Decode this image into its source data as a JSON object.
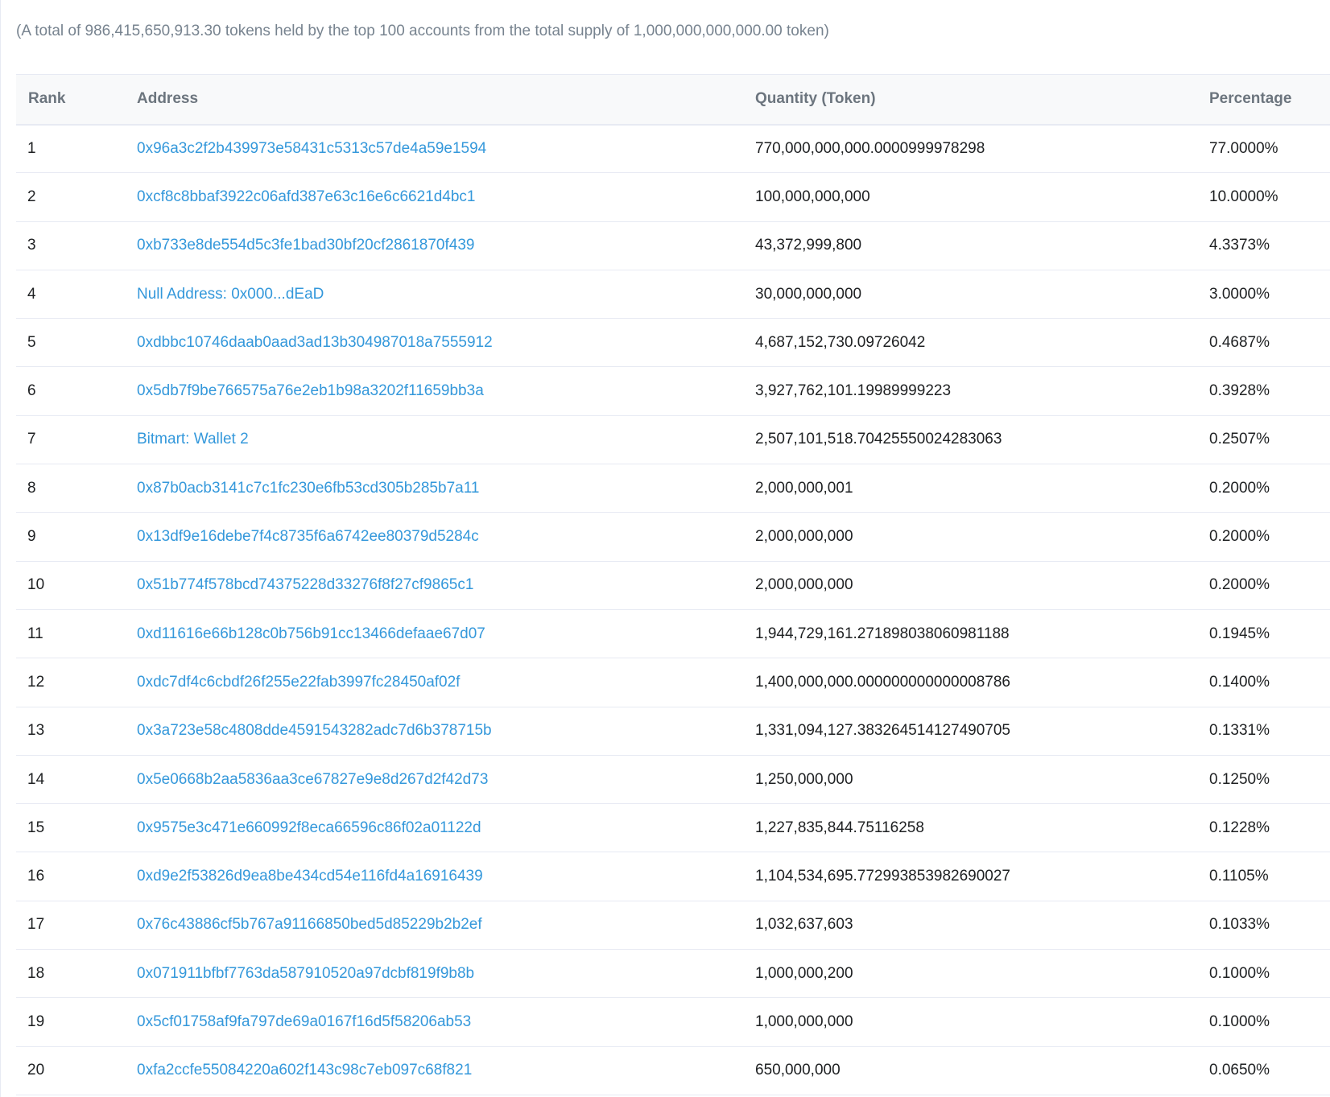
{
  "summary": "(A total of 986,415,650,913.30 tokens held by the top 100 accounts from the total supply of 1,000,000,000,000.00 token)",
  "table": {
    "headers": {
      "rank": "Rank",
      "address": "Address",
      "quantity": "Quantity (Token)",
      "percentage": "Percentage"
    },
    "rows": [
      {
        "rank": "1",
        "address": "0x96a3c2f2b439973e58431c5313c57de4a59e1594",
        "quantity": "770,000,000,000.0000999978298",
        "percentage": "77.0000%"
      },
      {
        "rank": "2",
        "address": "0xcf8c8bbaf3922c06afd387e63c16e6c6621d4bc1",
        "quantity": "100,000,000,000",
        "percentage": "10.0000%"
      },
      {
        "rank": "3",
        "address": "0xb733e8de554d5c3fe1bad30bf20cf2861870f439",
        "quantity": "43,372,999,800",
        "percentage": "4.3373%"
      },
      {
        "rank": "4",
        "address": "Null Address: 0x000...dEaD",
        "quantity": "30,000,000,000",
        "percentage": "3.0000%"
      },
      {
        "rank": "5",
        "address": "0xdbbc10746daab0aad3ad13b304987018a7555912",
        "quantity": "4,687,152,730.09726042",
        "percentage": "0.4687%"
      },
      {
        "rank": "6",
        "address": "0x5db7f9be766575a76e2eb1b98a3202f11659bb3a",
        "quantity": "3,927,762,101.19989999223",
        "percentage": "0.3928%"
      },
      {
        "rank": "7",
        "address": "Bitmart: Wallet 2",
        "quantity": "2,507,101,518.70425550024283063",
        "percentage": "0.2507%"
      },
      {
        "rank": "8",
        "address": "0x87b0acb3141c7c1fc230e6fb53cd305b285b7a11",
        "quantity": "2,000,000,001",
        "percentage": "0.2000%"
      },
      {
        "rank": "9",
        "address": "0x13df9e16debe7f4c8735f6a6742ee80379d5284c",
        "quantity": "2,000,000,000",
        "percentage": "0.2000%"
      },
      {
        "rank": "10",
        "address": "0x51b774f578bcd74375228d33276f8f27cf9865c1",
        "quantity": "2,000,000,000",
        "percentage": "0.2000%"
      },
      {
        "rank": "11",
        "address": "0xd11616e66b128c0b756b91cc13466defaae67d07",
        "quantity": "1,944,729,161.271898038060981188",
        "percentage": "0.1945%"
      },
      {
        "rank": "12",
        "address": "0xdc7df4c6cbdf26f255e22fab3997fc28450af02f",
        "quantity": "1,400,000,000.000000000000008786",
        "percentage": "0.1400%"
      },
      {
        "rank": "13",
        "address": "0x3a723e58c4808dde4591543282adc7d6b378715b",
        "quantity": "1,331,094,127.383264514127490705",
        "percentage": "0.1331%"
      },
      {
        "rank": "14",
        "address": "0x5e0668b2aa5836aa3ce67827e9e8d267d2f42d73",
        "quantity": "1,250,000,000",
        "percentage": "0.1250%"
      },
      {
        "rank": "15",
        "address": "0x9575e3c471e660992f8eca66596c86f02a01122d",
        "quantity": "1,227,835,844.75116258",
        "percentage": "0.1228%"
      },
      {
        "rank": "16",
        "address": "0xd9e2f53826d9ea8be434cd54e116fd4a16916439",
        "quantity": "1,104,534,695.772993853982690027",
        "percentage": "0.1105%"
      },
      {
        "rank": "17",
        "address": "0x76c43886cf5b767a91166850bed5d85229b2b2ef",
        "quantity": "1,032,637,603",
        "percentage": "0.1033%"
      },
      {
        "rank": "18",
        "address": "0x071911bfbf7763da587910520a97dcbf819f9b8b",
        "quantity": "1,000,000,200",
        "percentage": "0.1000%"
      },
      {
        "rank": "19",
        "address": "0x5cf01758af9fa797de69a0167f16d5f58206ab53",
        "quantity": "1,000,000,000",
        "percentage": "0.1000%"
      },
      {
        "rank": "20",
        "address": "0xfa2ccfe55084220a602f143c98c7eb097c68f821",
        "quantity": "650,000,000",
        "percentage": "0.0650%"
      }
    ]
  },
  "colors": {
    "link": "#3498db",
    "muted_text": "#77838f",
    "header_bg": "#f8f9fa",
    "border": "#e7eaf3"
  }
}
